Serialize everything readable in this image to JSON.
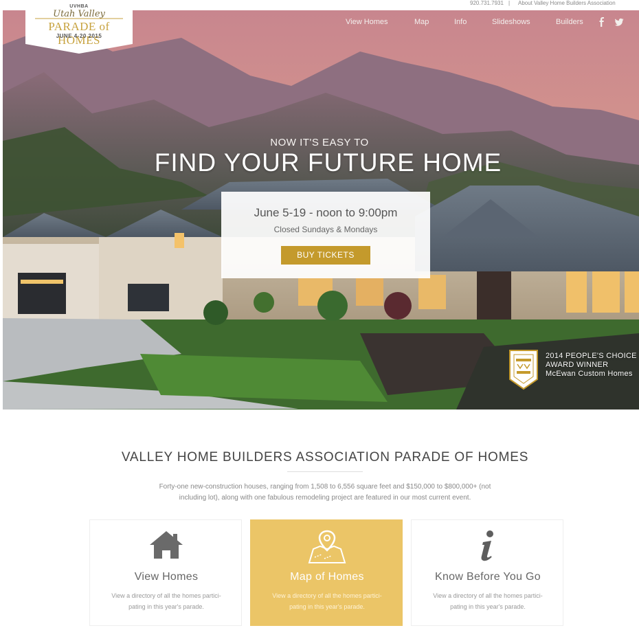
{
  "utility_bar": {
    "phone": "920.731.7931",
    "separator": "|",
    "about_link": "About Valley Home Builders Association"
  },
  "logo": {
    "org": "UVHBA",
    "script": "Utah Valley",
    "title": "PARADE of HOMES",
    "dates": "JUNE 4-20 2015"
  },
  "nav": {
    "items": [
      "View Homes",
      "Map",
      "Info",
      "Slideshows",
      "Builders"
    ],
    "social_icons": [
      "facebook-icon",
      "twitter-icon"
    ]
  },
  "hero": {
    "kicker": "NOW IT'S EASY TO",
    "headline": "FIND YOUR FUTURE HOME",
    "event_dates": "June 5-19 - noon to 9:00pm",
    "closed_note": "Closed Sundays & Mondays",
    "cta_label": "BUY TICKETS",
    "award": {
      "line1": "2014 PEOPLE'S CHOICE",
      "line2": "AWARD WINNER",
      "line3": "McEwan Custom Homes"
    }
  },
  "section": {
    "title": "VALLEY HOME BUILDERS ASSOCIATION PARADE OF HOMES",
    "description_line1": "Forty-one new-construction houses, ranging from 1,508 to 6,556 square feet and $150,000 to $800,000+ (not",
    "description_line2": "including lot), along with one fabulous remodeling project are featured in our most current event."
  },
  "cards": [
    {
      "title": "View Homes",
      "line1": "View a directory of all the homes partici-",
      "line2": "pating in this year's parade.",
      "icon": "house-icon"
    },
    {
      "title": "Map of Homes",
      "line1": "View a directory of all the homes partici-",
      "line2": "pating in this year's parade.",
      "icon": "map-pin-icon"
    },
    {
      "title": "Know Before You Go",
      "line1": "View a directory of all the homes partici-",
      "line2": "pating in this year's parade.",
      "icon": "info-icon"
    }
  ],
  "colors": {
    "accent_gold": "#c49a2c",
    "card_highlight": "#ebc567",
    "text_dark": "#444444",
    "text_muted": "#888888"
  }
}
